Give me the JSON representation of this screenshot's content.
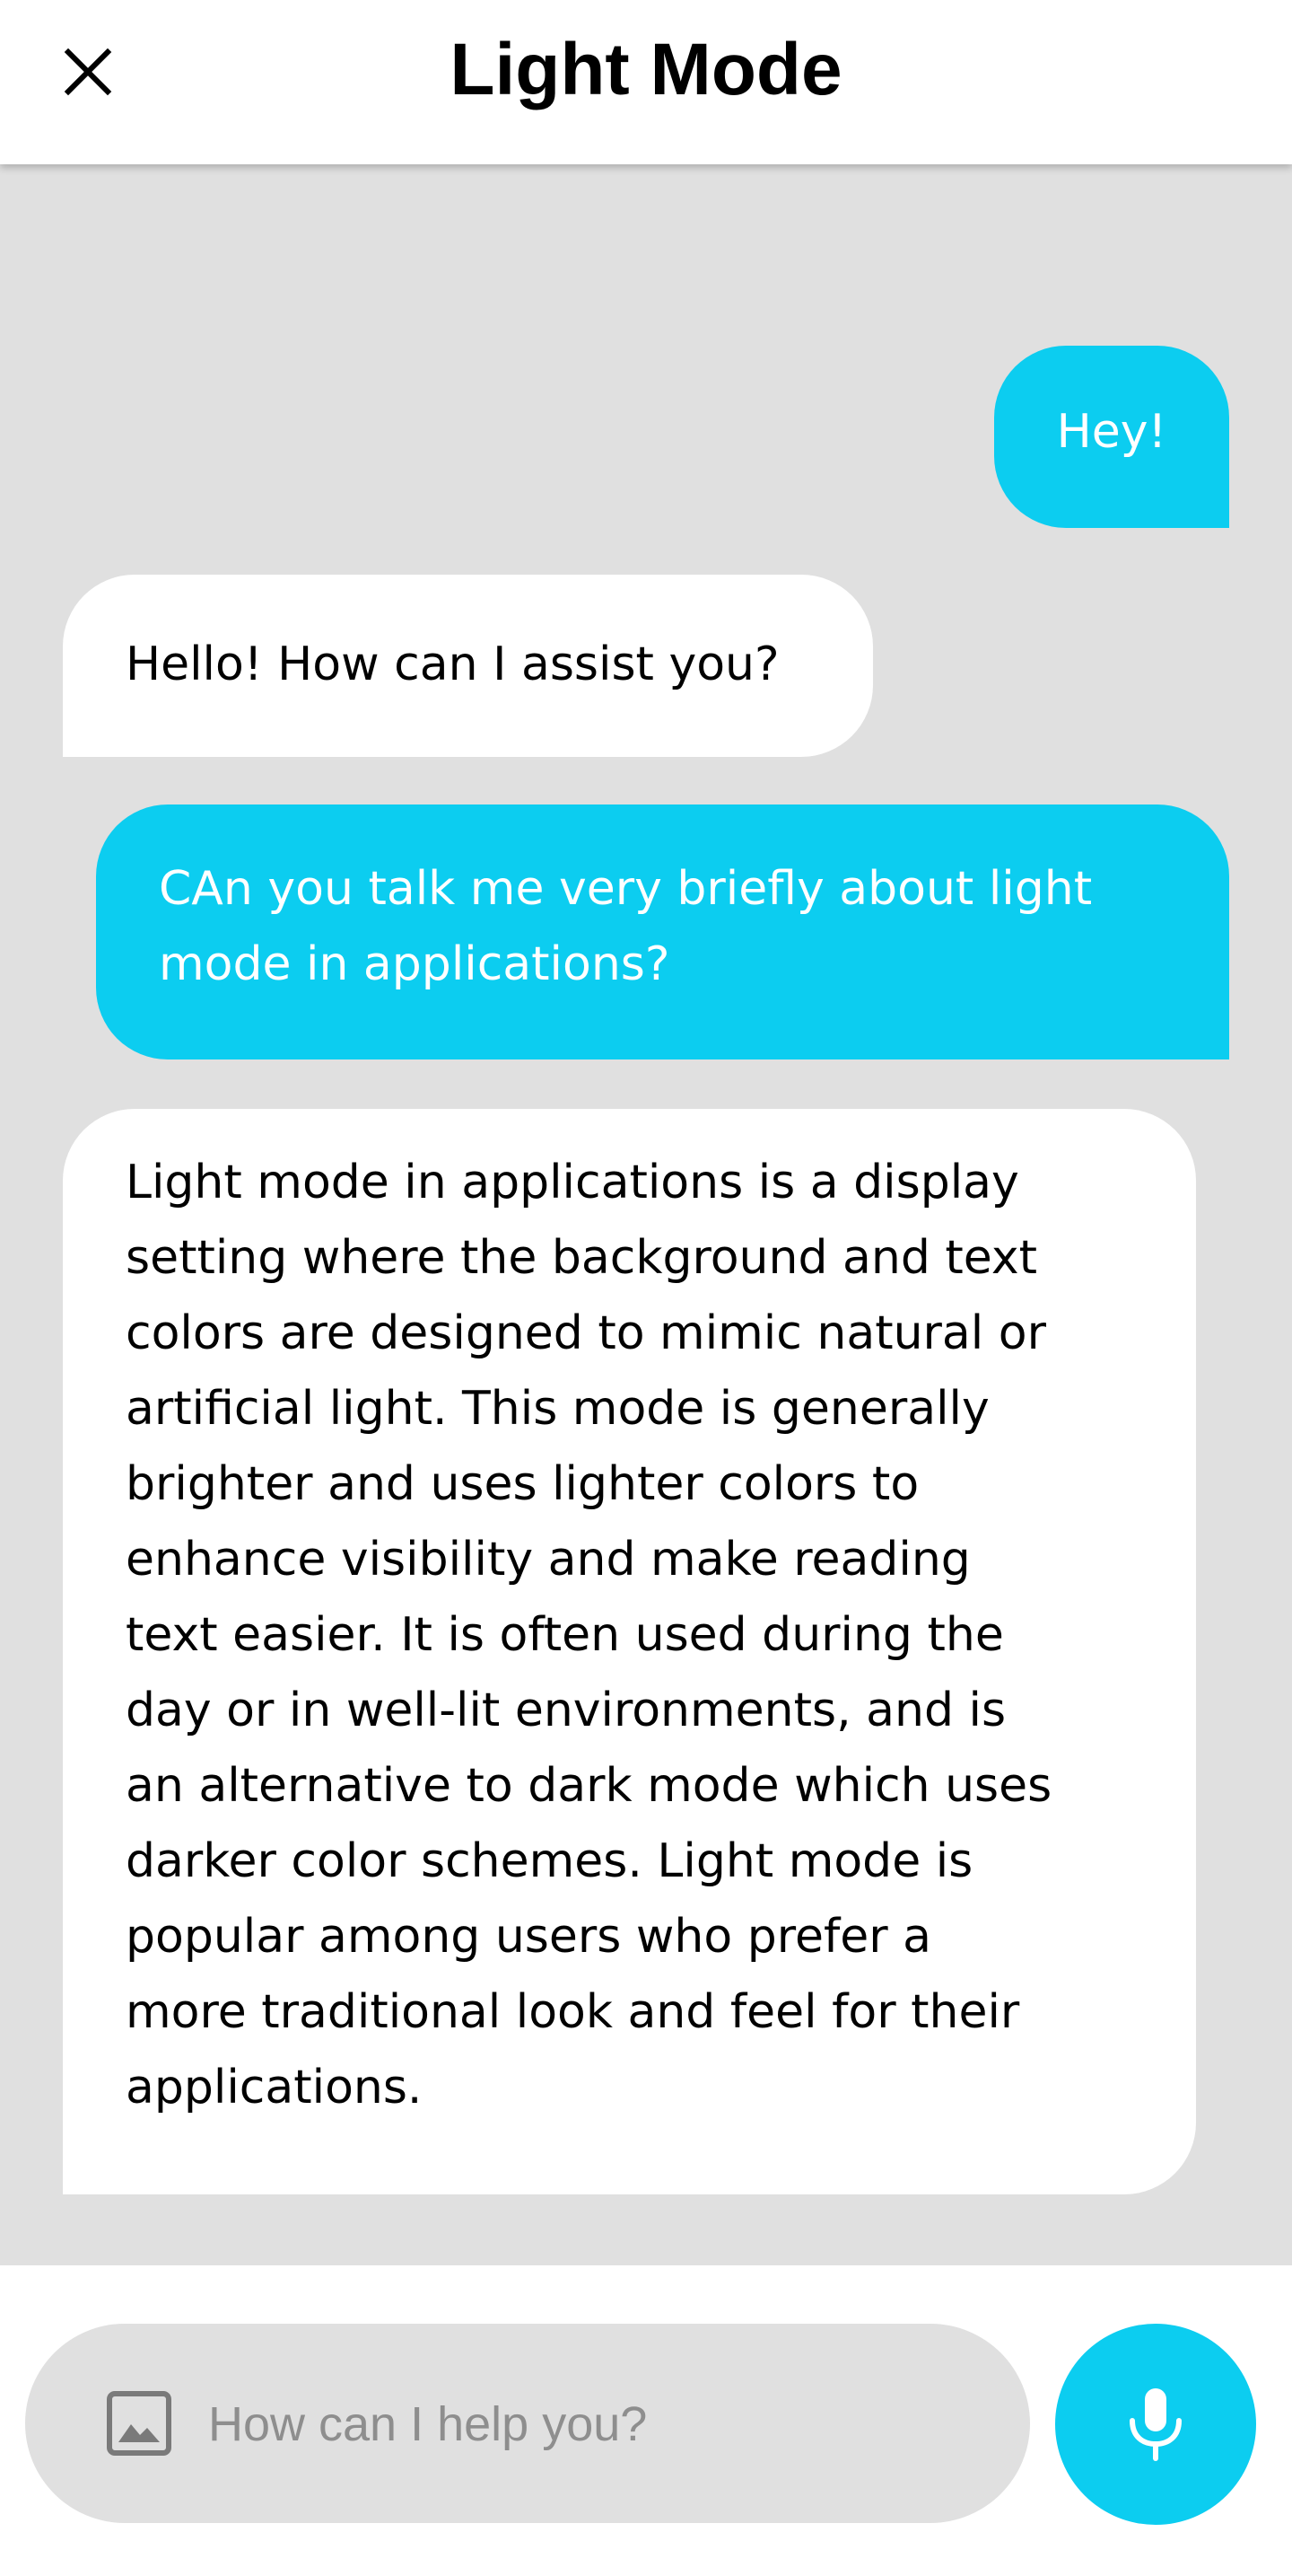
{
  "header": {
    "title": "Light Mode",
    "close_icon": "close-icon"
  },
  "messages": [
    {
      "role": "user",
      "text": "Hey!"
    },
    {
      "role": "assistant",
      "text": "Hello! How can I assist you?"
    },
    {
      "role": "user",
      "text": "CAn you talk me very briefly about light\nmode in applications?"
    },
    {
      "role": "assistant",
      "text": "Light mode in applications is a display\nsetting where the background and text\ncolors are designed to mimic natural or\nartificial light. This mode is generally\nbrighter and uses lighter colors to\nenhance visibility and make reading\ntext easier. It is often used during the\nday or in well-lit environments, and is\nan alternative to dark mode which uses\ndarker color schemes. Light mode is\npopular among users who prefer a\nmore traditional look and feel for their\napplications."
    }
  ],
  "composer": {
    "placeholder": "How can I help you?",
    "value": "",
    "image_icon": "image-icon",
    "mic_icon": "microphone-icon"
  },
  "colors": {
    "accent": "#0ccdf0",
    "chat_background": "#e0e0e0",
    "bot_bubble": "#ffffff",
    "user_text": "#ffffff",
    "bot_text": "#000000"
  }
}
